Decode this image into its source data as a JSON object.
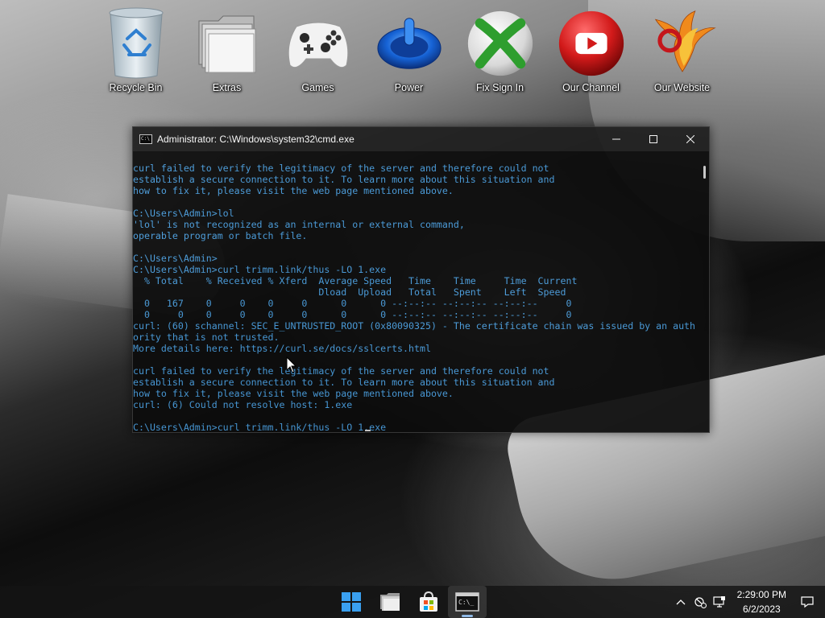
{
  "desktop": {
    "icons": [
      {
        "label": "Recycle Bin",
        "icon": "recycle-bin-icon"
      },
      {
        "label": "Extras",
        "icon": "folder-icon"
      },
      {
        "label": "Games",
        "icon": "xbox-controller-icon"
      },
      {
        "label": "Power",
        "icon": "power-icon"
      },
      {
        "label": "Fix Sign In",
        "icon": "xbox-logo-icon"
      },
      {
        "label": "Our Channel",
        "icon": "youtube-icon"
      },
      {
        "label": "Our Website",
        "icon": "phoenix-logo-icon"
      }
    ]
  },
  "cmd_window": {
    "title": "Administrator: C:\\Windows\\system32\\cmd.exe",
    "icon": "cmd-icon",
    "controls": {
      "minimize": "minimize-icon",
      "maximize": "maximize-icon",
      "close": "close-icon"
    },
    "lines": [
      "curl failed to verify the legitimacy of the server and therefore could not",
      "establish a secure connection to it. To learn more about this situation and",
      "how to fix it, please visit the web page mentioned above.",
      "",
      "C:\\Users\\Admin>lol",
      "'lol' is not recognized as an internal or external command,",
      "operable program or batch file.",
      "",
      "C:\\Users\\Admin>",
      "C:\\Users\\Admin>curl trimm.link/thus -LO 1.exe",
      "  % Total    % Received % Xferd  Average Speed   Time    Time     Time  Current",
      "                                 Dload  Upload   Total   Spent    Left  Speed",
      "  0   167    0     0    0     0      0      0 --:--:-- --:--:-- --:--:--     0",
      "  0     0    0     0    0     0      0      0 --:--:-- --:--:-- --:--:--     0",
      "curl: (60) schannel: SEC_E_UNTRUSTED_ROOT (0x80090325) - The certificate chain was issued by an auth",
      "ority that is not trusted.",
      "More details here: https://curl.se/docs/sslcerts.html",
      "",
      "curl failed to verify the legitimacy of the server and therefore could not",
      "establish a secure connection to it. To learn more about this situation and",
      "how to fix it, please visit the web page mentioned above.",
      "curl: (6) Could not resolve host: 1.exe",
      "",
      "C:\\Users\\Admin>curl trimm.link/thus -LO 1.exe"
    ]
  },
  "taskbar": {
    "apps": [
      {
        "name": "start",
        "icon": "windows-start-icon"
      },
      {
        "name": "file-explorer",
        "icon": "file-explorer-icon"
      },
      {
        "name": "microsoft-store",
        "icon": "microsoft-store-icon"
      },
      {
        "name": "command-prompt",
        "icon": "terminal-icon",
        "active": true
      }
    ],
    "tray": {
      "icons": [
        "chevron-up-icon",
        "network-disconnected-icon",
        "display-icon"
      ],
      "time": "2:29:00 PM",
      "date": "6/2/2023",
      "notification_icon": "notification-icon"
    }
  }
}
